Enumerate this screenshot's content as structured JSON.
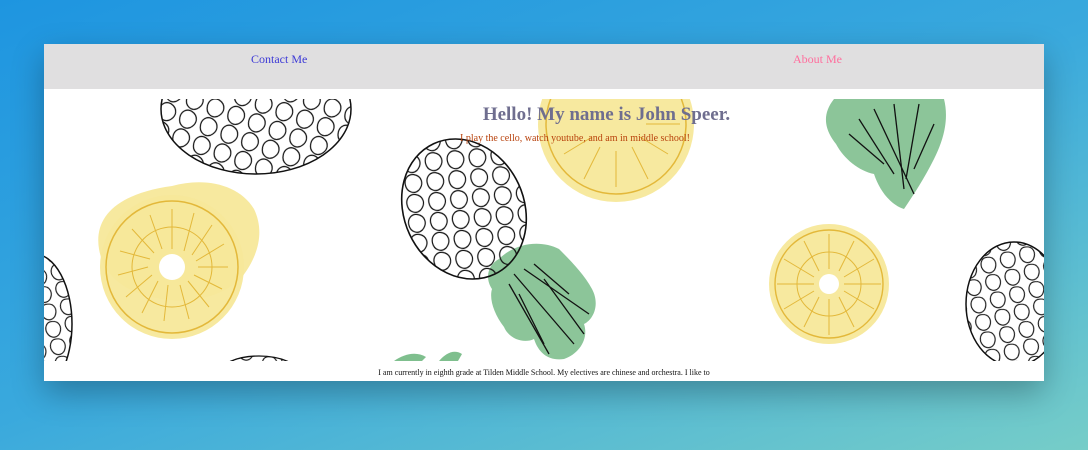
{
  "nav": {
    "contact_label": "Contact Me",
    "about_label": "About Me"
  },
  "hero": {
    "title": "Hello! My name is John Speer.",
    "subtitle": "I play the cello, watch youtube, and am in middle school!"
  },
  "bio": {
    "text": "I am currently in eighth grade at Tilden Middle School. My electives are chinese and orchestra. I like to"
  },
  "colors": {
    "background_gradient_start": "#1e95e0",
    "background_gradient_end": "#76cdc8",
    "navbar": "#e0dfe0",
    "contact_link": "#3d3ad6",
    "about_link": "#ff6e9d",
    "title": "#6f6e8f",
    "subtitle": "#b8420c",
    "pineapple_slice_fill": "#f7e89a",
    "pineapple_slice_stroke": "#e3b83a",
    "pineapple_leaf": "#7fbf8e",
    "outline": "#111111"
  },
  "icons": {
    "hero_pattern": "pineapple-pattern"
  }
}
